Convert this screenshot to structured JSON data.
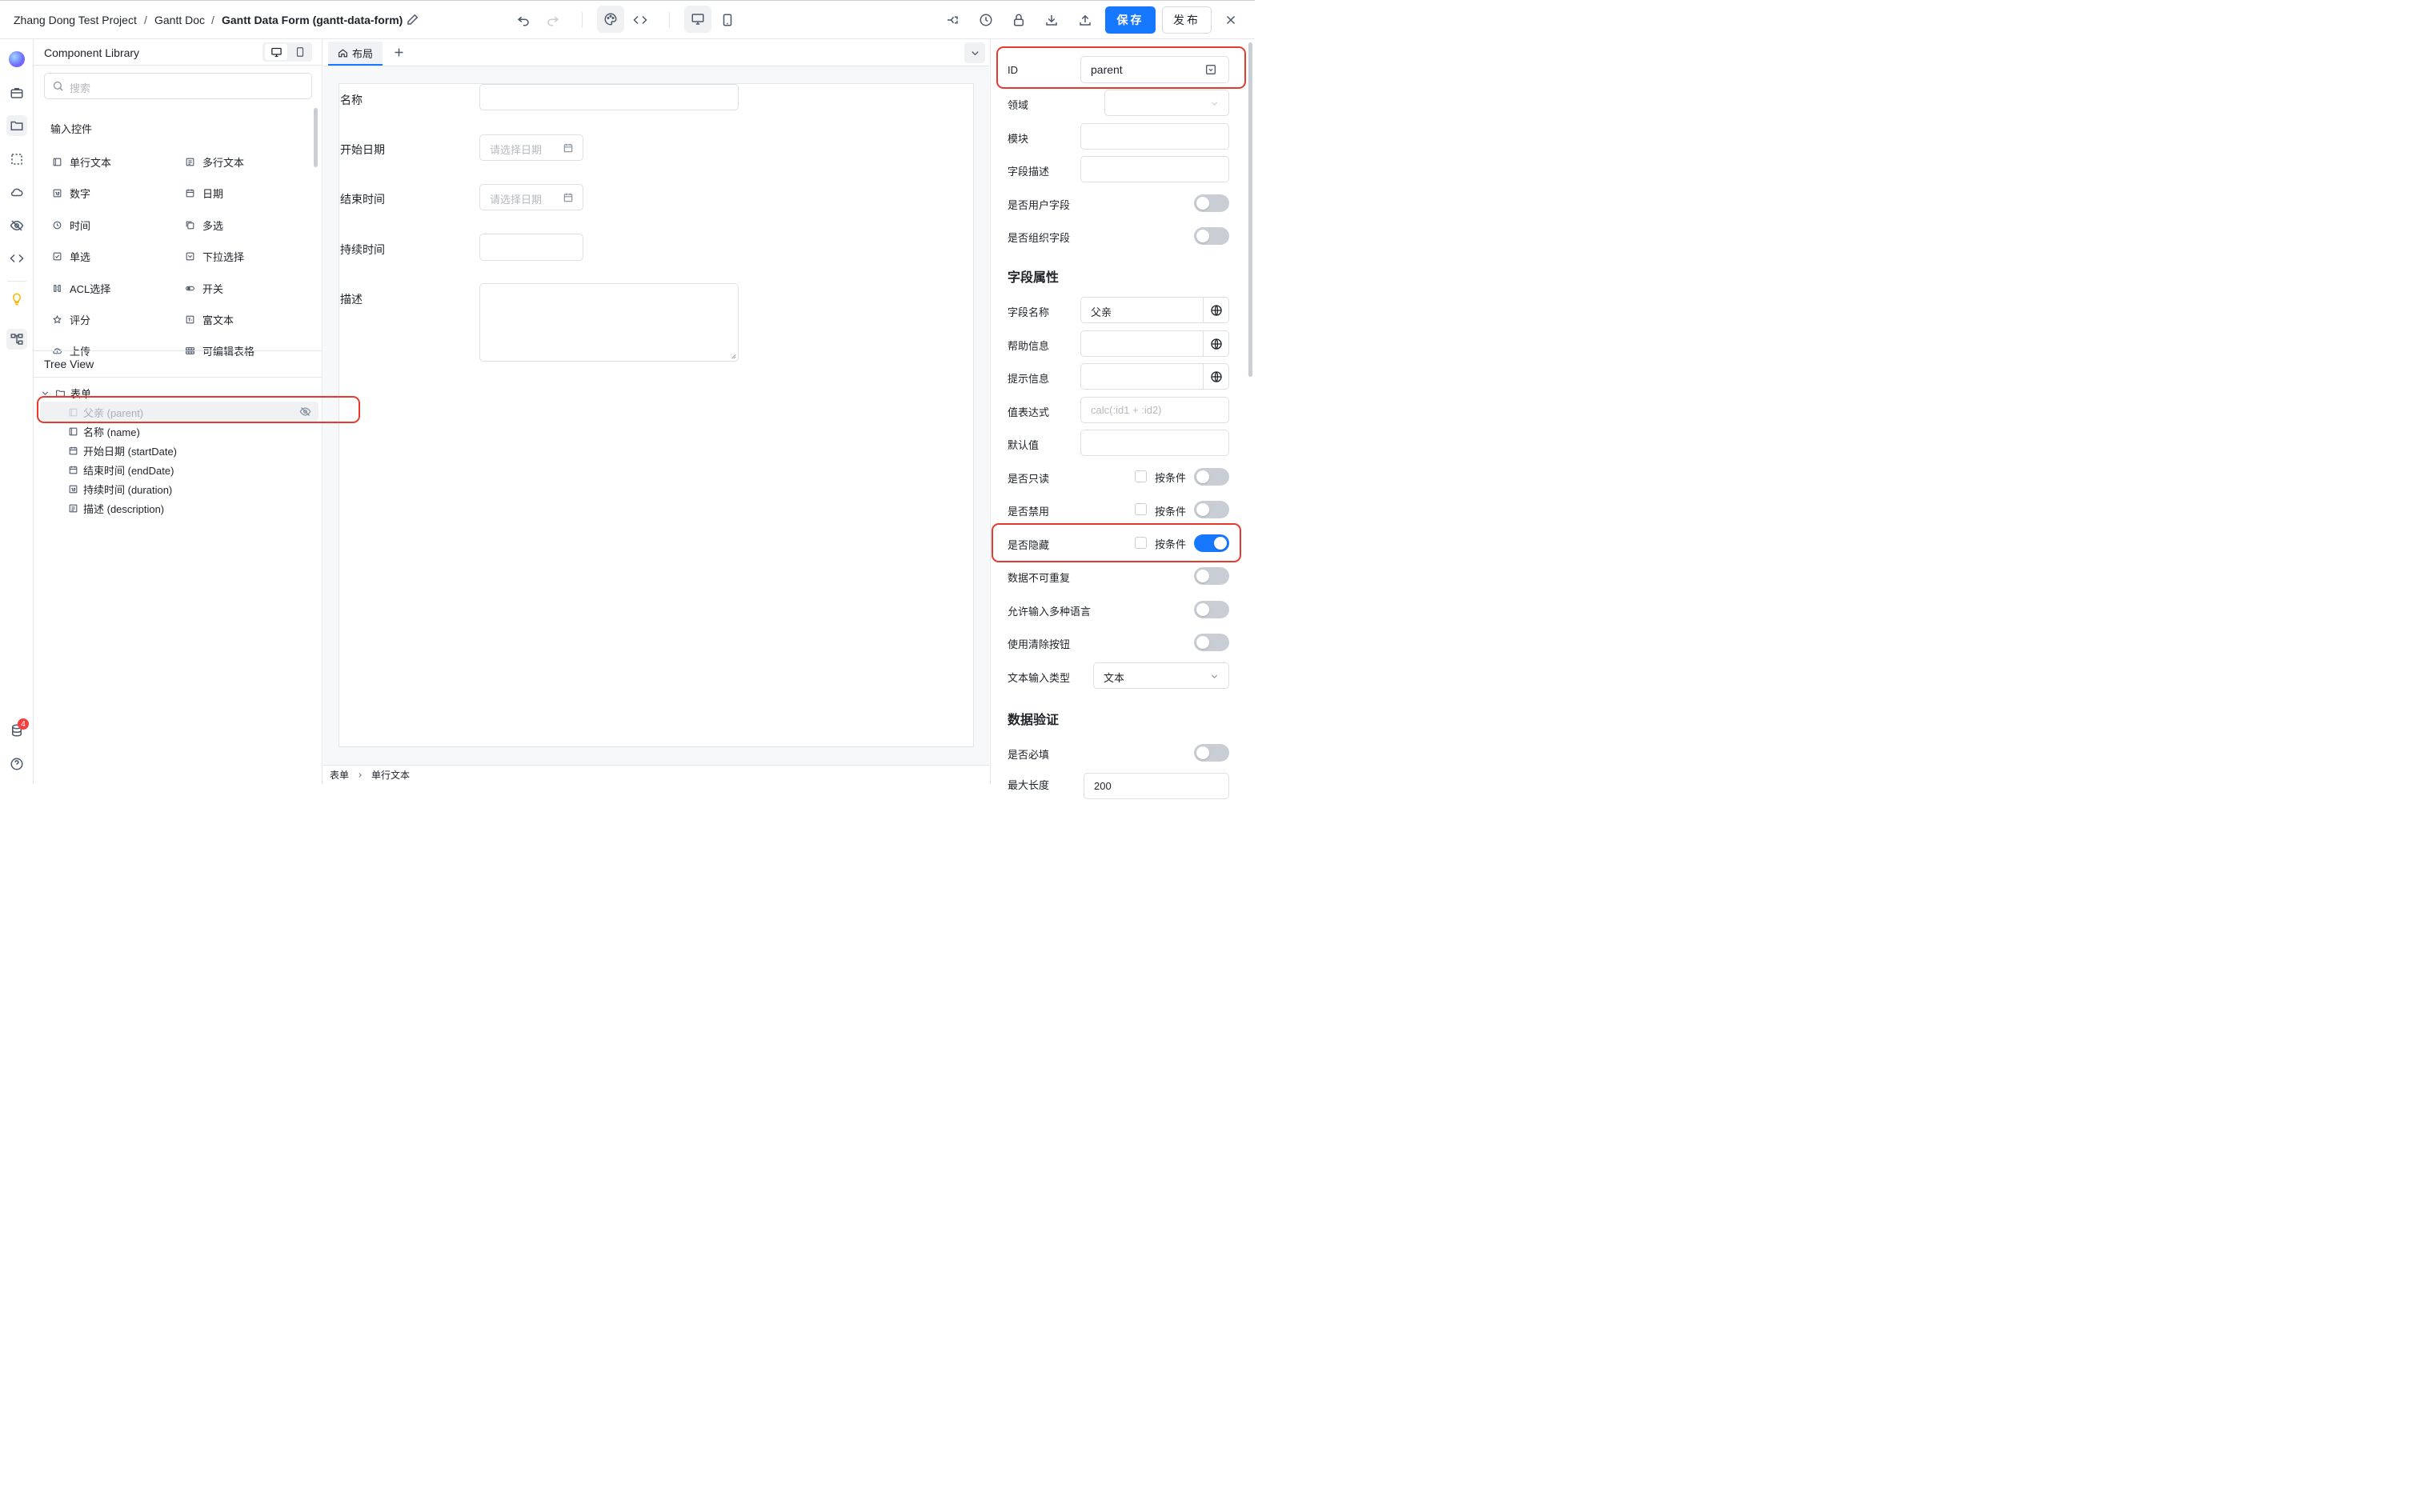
{
  "header": {
    "breadcrumb": [
      "Zhang Dong Test Project",
      "/",
      "Gantt Doc",
      "/",
      "Gantt Data Form (gantt-data-form)"
    ],
    "save_label": "保存",
    "publish_label": "发布"
  },
  "library": {
    "title": "Component Library",
    "search_placeholder": "搜索",
    "group_title": "输入控件",
    "components": [
      {
        "label": "单行文本",
        "icon": "single-line-text-icon"
      },
      {
        "label": "多行文本",
        "icon": "multi-line-text-icon"
      },
      {
        "label": "数字",
        "icon": "number-icon"
      },
      {
        "label": "日期",
        "icon": "date-icon"
      },
      {
        "label": "时间",
        "icon": "time-icon"
      },
      {
        "label": "多选",
        "icon": "multi-select-icon"
      },
      {
        "label": "单选",
        "icon": "radio-icon"
      },
      {
        "label": "下拉选择",
        "icon": "dropdown-icon"
      },
      {
        "label": "ACL选择",
        "icon": "acl-icon"
      },
      {
        "label": "开关",
        "icon": "switch-icon"
      },
      {
        "label": "评分",
        "icon": "rating-icon"
      },
      {
        "label": "富文本",
        "icon": "rich-text-icon"
      },
      {
        "label": "上传",
        "icon": "upload-icon"
      },
      {
        "label": "可编辑表格",
        "icon": "table-icon"
      }
    ]
  },
  "tree": {
    "title": "Tree View",
    "root": "表单",
    "items": [
      {
        "label": "父亲 (parent)",
        "hidden": true
      },
      {
        "label": "名称 (name)"
      },
      {
        "label": "开始日期 (startDate)"
      },
      {
        "label": "结束时间 (endDate)"
      },
      {
        "label": "持续时间 (duration)"
      },
      {
        "label": "描述 (description)"
      }
    ]
  },
  "canvas": {
    "tab_label": "布局",
    "fields": [
      {
        "label": "名称"
      },
      {
        "label": "开始日期",
        "placeholder": "请选择日期"
      },
      {
        "label": "结束时间",
        "placeholder": "请选择日期"
      },
      {
        "label": "持续时间"
      },
      {
        "label": "描述"
      }
    ],
    "status_path": [
      "表单",
      "单行文本"
    ]
  },
  "props": {
    "id_label": "ID",
    "id_value": "parent",
    "domain_label": "领域",
    "module_label": "模块",
    "field_desc_label": "字段描述",
    "is_user_field_label": "是否用户字段",
    "is_org_field_label": "是否组织字段",
    "section_field_props": "字段属性",
    "field_name_label": "字段名称",
    "field_name_value": "父亲",
    "help_label": "帮助信息",
    "hint_label": "提示信息",
    "expr_label": "值表达式",
    "expr_placeholder": "calc(:id1 + :id2)",
    "default_label": "默认值",
    "readonly_label": "是否只读",
    "disabled_label": "是否禁用",
    "hidden_label": "是否隐藏",
    "conditional_label": "按条件",
    "unique_label": "数据不可重复",
    "multilang_label": "允许输入多种语言",
    "clear_btn_label": "使用清除按钮",
    "input_type_label": "文本输入类型",
    "input_type_value": "文本",
    "section_validation": "数据验证",
    "required_label": "是否必填",
    "max_length_label": "最大长度",
    "max_length_value": "200",
    "toggles": {
      "is_user_field": false,
      "is_org_field": false,
      "readonly": false,
      "disabled": false,
      "hidden": true,
      "unique": false,
      "multilang": false,
      "clear_btn": false,
      "required": false
    }
  },
  "rail": {
    "badge_count": "4"
  },
  "colors": {
    "primary": "#1677ff",
    "highlight": "#e8392e"
  }
}
